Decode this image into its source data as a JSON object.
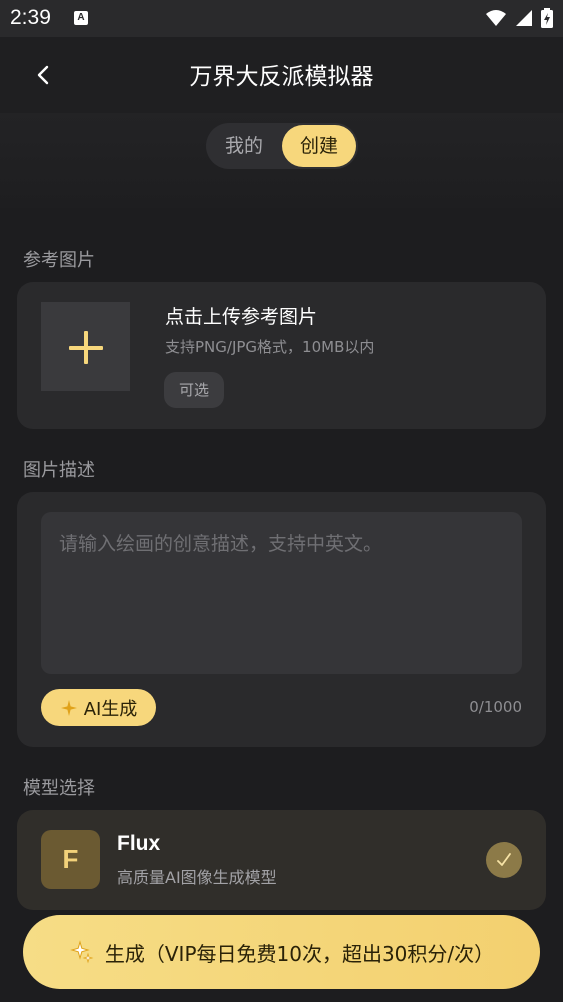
{
  "status_bar": {
    "time": "2:39",
    "badge": "A"
  },
  "header": {
    "title": "万界大反派模拟器"
  },
  "segment": {
    "mine_label": "我的",
    "create_label": "创建",
    "active": "create"
  },
  "reference": {
    "section_label": "参考图片",
    "upload_title": "点击上传参考图片",
    "upload_subtitle": "支持PNG/JPG格式，10MB以内",
    "optional_tag": "可选"
  },
  "description": {
    "section_label": "图片描述",
    "placeholder": "请输入绘画的创意描述，支持中英文。",
    "value": "",
    "ai_button_label": "AI生成",
    "counter": "0/1000"
  },
  "model": {
    "section_label": "模型选择",
    "selected": {
      "logo_letter": "F",
      "name": "Flux",
      "description": "高质量AI图像生成模型",
      "checked": true
    }
  },
  "generate_button": {
    "label": "生成（VIP每日免费10次，超出30积分/次）"
  },
  "colors": {
    "accent": "#f7d77c",
    "background": "#1d1d1f",
    "card": "#2a2a2c"
  }
}
